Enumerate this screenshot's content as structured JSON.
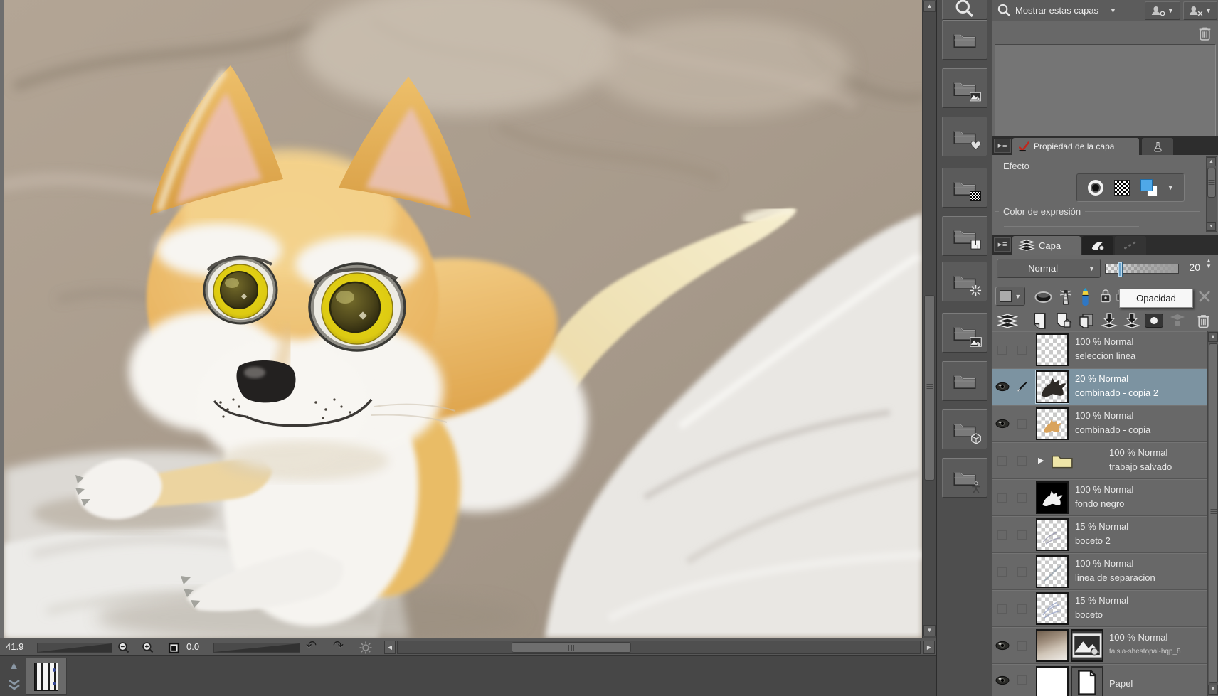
{
  "canvas": {
    "alt": "cartoon fox with large yellow eyes lying on rumpled white and tan bedding"
  },
  "statusbar": {
    "zoom_level": "41.9",
    "rotation_angle": "0.0"
  },
  "search_panel": {
    "filter_label": "Mostrar estas capas"
  },
  "property_panel": {
    "tab_label": "Propiedad de la capa",
    "effect_label": "Efecto",
    "expression_label": "Color de expresión"
  },
  "layer_panel": {
    "tab_label": "Capa",
    "blend_mode": "Normal",
    "opacity_value": "20",
    "opacity_tooltip": "Opacidad"
  },
  "layers": [
    {
      "opacity": "100 % Normal",
      "name": "seleccion linea"
    },
    {
      "opacity": "20 % Normal",
      "name": "combinado - copia 2"
    },
    {
      "opacity": "100 % Normal",
      "name": "combinado - copia"
    },
    {
      "opacity": "100 % Normal",
      "name": "trabajo salvado"
    },
    {
      "opacity": "100 % Normal",
      "name": "fondo negro"
    },
    {
      "opacity": "15 % Normal",
      "name": "boceto 2"
    },
    {
      "opacity": "100 % Normal",
      "name": "linea de separacion"
    },
    {
      "opacity": "15 % Normal",
      "name": "boceto"
    },
    {
      "opacity": "100 % Normal",
      "name": "taisia-shestopal-hqp_8"
    },
    {
      "opacity": "",
      "name": "Papel"
    }
  ],
  "glyphs": {
    "down": "▼",
    "up": "▲",
    "left": "◀",
    "right": "▶",
    "undo": "↶",
    "redo": "↷",
    "menu": "≡",
    "expand": "▶",
    "spin_up": "▲",
    "spin_down": "▼",
    "collapse_up": "▲"
  },
  "colors": {
    "selected_row": "#7c93a1",
    "opacity_handle": "#6ba3cc",
    "layer_color_chip": "#4fa8e8",
    "property_check_red": "#c0271d",
    "panel_gray": "#686868"
  }
}
